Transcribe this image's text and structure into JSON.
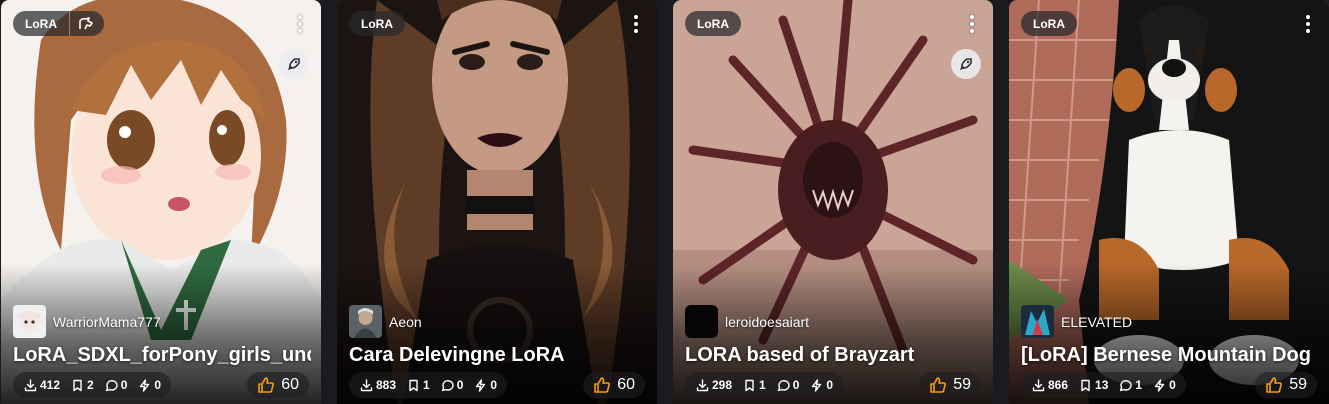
{
  "cards": [
    {
      "type_badge": "LoRA",
      "creator": "WarriorMama777",
      "title": "LoRA_SDXL_forPony_girls_und_panzer",
      "stats": {
        "downloads": "412",
        "bookmarks": "2",
        "comments": "0",
        "buzz": "0"
      },
      "likes": "60",
      "has_rocket": true
    },
    {
      "type_badge": "LoRA",
      "creator": "Aeon",
      "title": "Cara Delevingne LoRA",
      "stats": {
        "downloads": "883",
        "bookmarks": "1",
        "comments": "0",
        "buzz": "0"
      },
      "likes": "60",
      "has_rocket": false
    },
    {
      "type_badge": "LoRA",
      "creator": "leroidoesaiart",
      "title": "LORA based of Brayzart",
      "stats": {
        "downloads": "298",
        "bookmarks": "1",
        "comments": "0",
        "buzz": "0"
      },
      "likes": "59",
      "has_rocket": true
    },
    {
      "type_badge": "LoRA",
      "creator": "ELEVATED",
      "title": "[LoRA] Bernese Mountain Dog",
      "stats": {
        "downloads": "866",
        "bookmarks": "13",
        "comments": "1",
        "buzz": "0"
      },
      "likes": "59",
      "has_rocket": false
    }
  ],
  "colors": {
    "page_bg": "#1a1b1e",
    "like_icon": "#f59f00",
    "badge_bg": "#28282c"
  },
  "icons": [
    "horse-flag-icon",
    "more-vertical-icon",
    "rocket-icon",
    "download-icon",
    "bookmark-icon",
    "comment-icon",
    "bolt-icon",
    "thumb-up-icon"
  ]
}
